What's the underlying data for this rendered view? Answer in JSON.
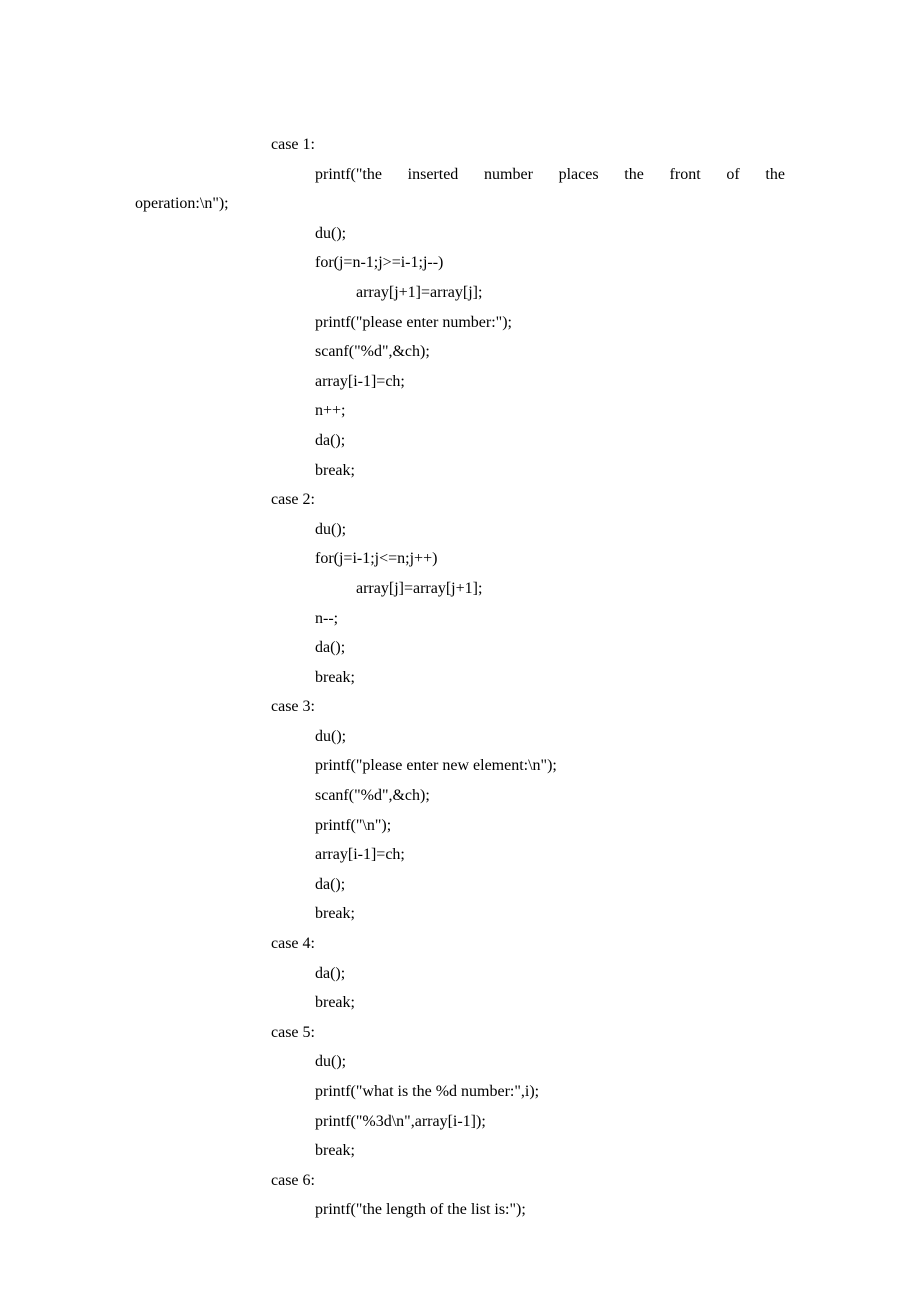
{
  "lines": [
    {
      "indent": 136,
      "text": "case 1:"
    },
    {
      "indent": 180,
      "justified": true,
      "words": [
        "printf(\"the",
        "inserted",
        "number",
        "places",
        "the",
        "front",
        "of",
        "the"
      ]
    },
    {
      "indent": 0,
      "text": "operation:\\n\");"
    },
    {
      "indent": 180,
      "text": "du();"
    },
    {
      "indent": 180,
      "text": "for(j=n-1;j>=i-1;j--)"
    },
    {
      "indent": 221,
      "text": "array[j+1]=array[j];"
    },
    {
      "indent": 180,
      "text": "printf(\"please enter number:\");"
    },
    {
      "indent": 180,
      "text": "scanf(\"%d\",&ch);"
    },
    {
      "indent": 180,
      "text": "array[i-1]=ch;"
    },
    {
      "indent": 180,
      "text": "n++;"
    },
    {
      "indent": 180,
      "text": "da();"
    },
    {
      "indent": 180,
      "text": "break;"
    },
    {
      "indent": 136,
      "text": "case 2:"
    },
    {
      "indent": 180,
      "text": "du();"
    },
    {
      "indent": 180,
      "text": "for(j=i-1;j<=n;j++)"
    },
    {
      "indent": 221,
      "text": "array[j]=array[j+1];"
    },
    {
      "indent": 180,
      "text": "n--;"
    },
    {
      "indent": 180,
      "text": "da();"
    },
    {
      "indent": 180,
      "text": "break;"
    },
    {
      "indent": 136,
      "text": "case 3:"
    },
    {
      "indent": 180,
      "text": "du();"
    },
    {
      "indent": 180,
      "text": "printf(\"please enter new element:\\n\");"
    },
    {
      "indent": 180,
      "text": "scanf(\"%d\",&ch);"
    },
    {
      "indent": 180,
      "text": "printf(\"\\n\");"
    },
    {
      "indent": 180,
      "text": "array[i-1]=ch;"
    },
    {
      "indent": 180,
      "text": "da();"
    },
    {
      "indent": 180,
      "text": "break;"
    },
    {
      "indent": 136,
      "text": "case 4:"
    },
    {
      "indent": 180,
      "text": "da();"
    },
    {
      "indent": 180,
      "text": "break;"
    },
    {
      "indent": 136,
      "text": "case 5:"
    },
    {
      "indent": 180,
      "text": "du();"
    },
    {
      "indent": 180,
      "text": "printf(\"what is the %d number:\",i);"
    },
    {
      "indent": 180,
      "text": "printf(\"%3d\\n\",array[i-1]);"
    },
    {
      "indent": 180,
      "text": "break;"
    },
    {
      "indent": 136,
      "text": "case 6:"
    },
    {
      "indent": 180,
      "text": "printf(\"the length of the list is:\");"
    }
  ]
}
